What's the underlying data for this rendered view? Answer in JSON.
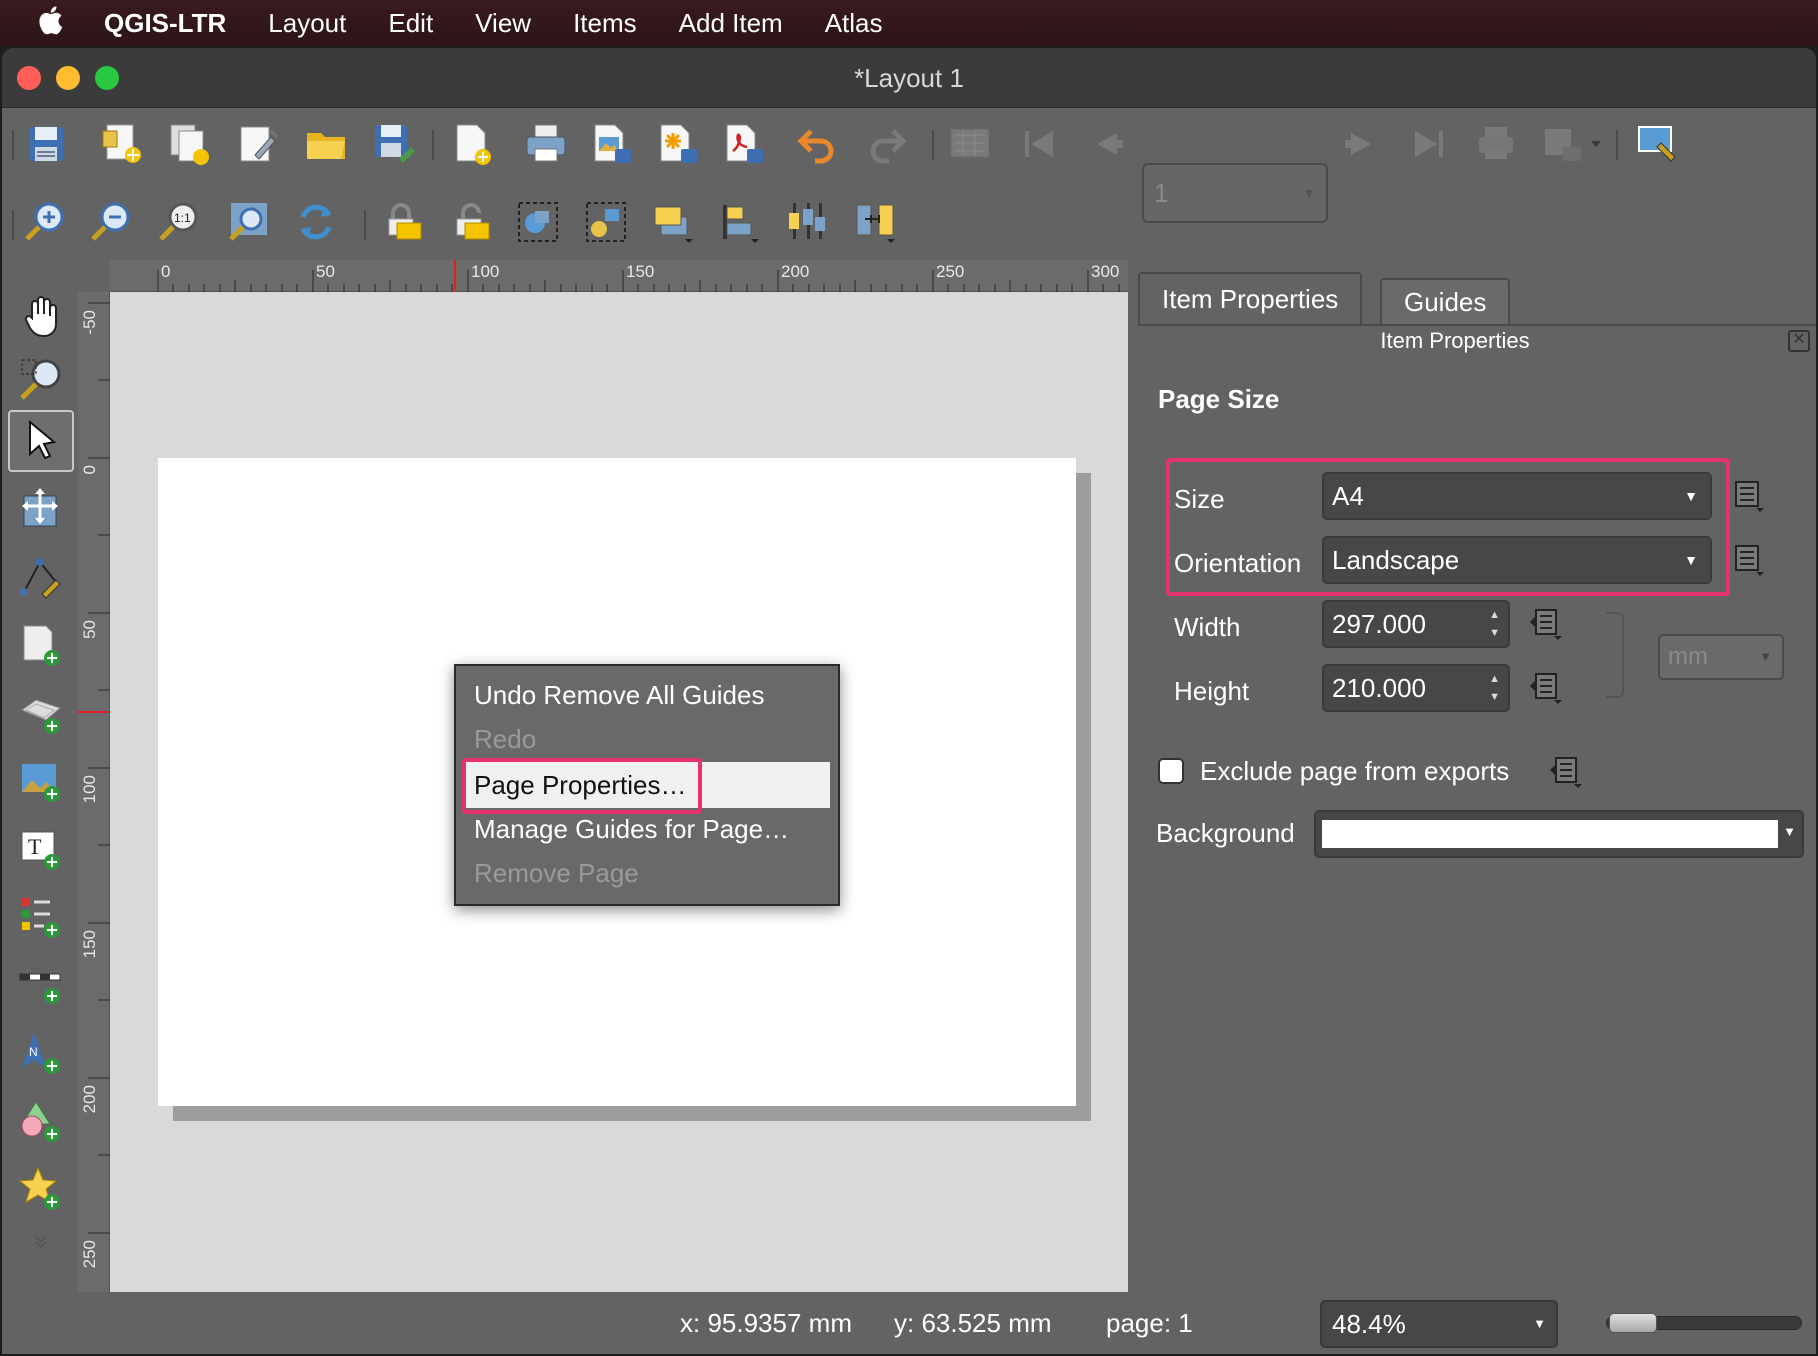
{
  "menubar": {
    "app": "QGIS-LTR",
    "items": [
      "Layout",
      "Edit",
      "View",
      "Items",
      "Add Item",
      "Atlas"
    ]
  },
  "window": {
    "title": "*Layout 1"
  },
  "toolbar": {
    "page_number": "1",
    "icons_row1": [
      "save-layout-icon",
      "new-layout-icon",
      "duplicate-layout-icon",
      "layout-manager-icon",
      "open-template-icon",
      "save-template-icon",
      "add-pages-icon",
      "print-icon",
      "export-image-icon",
      "export-svg-icon",
      "export-pdf-icon",
      "undo-icon",
      "redo-icon",
      "atlas-preview-icon",
      "first-feature-icon",
      "previous-feature-icon",
      "next-feature-icon",
      "last-feature-icon",
      "print-atlas-icon",
      "export-atlas-icon",
      "atlas-settings-icon"
    ],
    "icons_row2": [
      "zoom-in-icon",
      "zoom-out-icon",
      "zoom-100-icon",
      "zoom-full-icon",
      "refresh-icon",
      "lock-items-icon",
      "unlock-items-icon",
      "group-items-icon",
      "ungroup-items-icon",
      "raise-items-icon",
      "align-items-icon",
      "distribute-items-icon",
      "resize-items-icon"
    ]
  },
  "toolbox": [
    "pan-icon",
    "zoom-tool-icon",
    "select-move-icon",
    "move-content-icon",
    "edit-nodes-icon",
    "add-map-icon",
    "add-3d-map-icon",
    "add-picture-icon",
    "add-label-icon",
    "add-legend-icon",
    "add-scalebar-icon",
    "add-north-arrow-icon",
    "add-shape-icon",
    "add-marker-icon",
    "more-tools-icon"
  ],
  "rulers": {
    "horizontal": [
      "0",
      "50",
      "100",
      "150",
      "200",
      "250",
      "300"
    ],
    "vertical": [
      "-50",
      "0",
      "50",
      "100",
      "150",
      "200",
      "250"
    ]
  },
  "context_menu": {
    "items": [
      {
        "label": "Undo Remove All Guides",
        "enabled": true
      },
      {
        "label": "Redo",
        "enabled": false
      },
      {
        "label": "Page Properties…",
        "enabled": true,
        "highlighted": true
      },
      {
        "label": "Manage Guides for Page…",
        "enabled": true
      },
      {
        "label": "Remove Page",
        "enabled": false
      }
    ]
  },
  "dock": {
    "tabs": [
      "Item Properties",
      "Guides"
    ],
    "title": "Item Properties",
    "section_title": "Page Size",
    "size_label": "Size",
    "size_value": "A4",
    "orientation_label": "Orientation",
    "orientation_value": "Landscape",
    "width_label": "Width",
    "width_value": "297.000",
    "height_label": "Height",
    "height_value": "210.000",
    "unit_value": "mm",
    "exclude_label": "Exclude page from exports",
    "exclude_checked": false,
    "background_label": "Background",
    "background_color": "#ffffff"
  },
  "status": {
    "x": "x: 95.9357 mm",
    "y": "y: 63.525 mm",
    "page": "page: 1",
    "zoom": "48.4%"
  },
  "colors": {
    "highlight_border": "#e6336b",
    "panel_bg": "#636363",
    "canvas_bg": "#d9d9d9"
  }
}
